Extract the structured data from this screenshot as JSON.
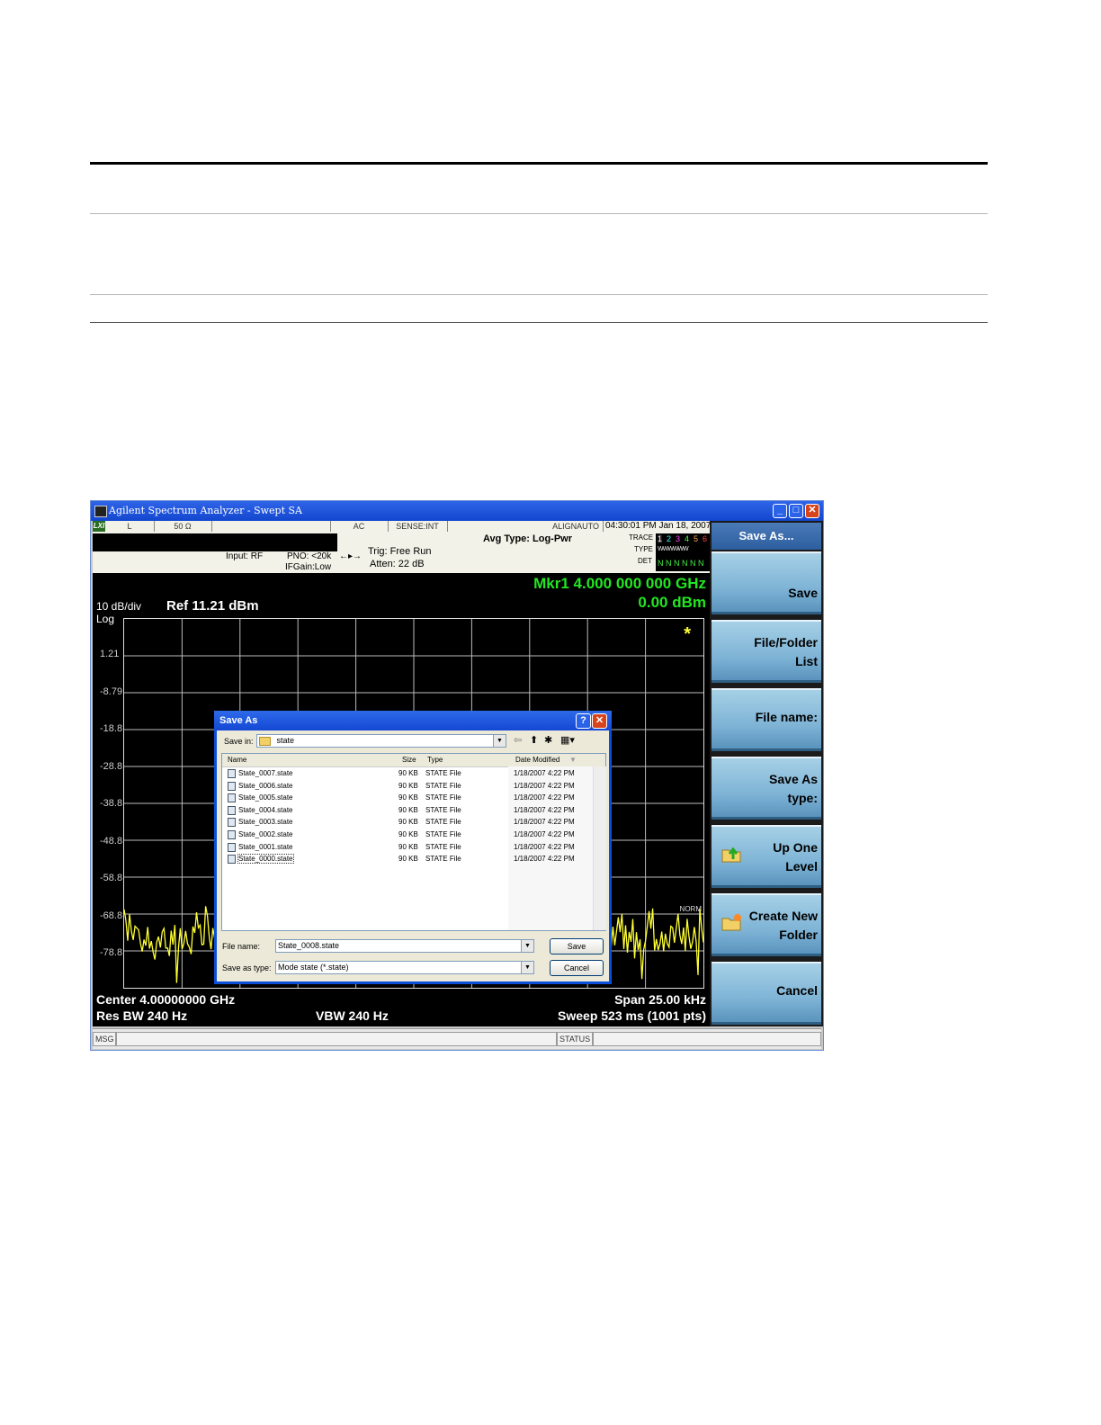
{
  "window": {
    "title": "Agilent Spectrum Analyzer - Swept SA"
  },
  "status": {
    "lxi": "LXI",
    "cells": [
      "L",
      "50 Ω",
      "",
      "AC",
      "SENSE:INT",
      "ALIGNAUTO"
    ],
    "datetime": "04:30:01 PM Jan 18, 2007",
    "input": "Input: RF",
    "pno": "PNO: <20k",
    "ifgain": "IFGain:Low",
    "trig": "Trig: Free Run",
    "atten": "Atten: 22 dB",
    "avg_type": "Avg Type: Log-Pwr",
    "trace_label": "TRACE",
    "type_label": "TYPE",
    "det_label": "DET",
    "trace_digits": [
      "1",
      "2",
      "3",
      "4",
      "5",
      "6"
    ],
    "type_value": "WWWWWW",
    "det_value": "N N N N N N"
  },
  "screen": {
    "scale": "10 dB/div",
    "log": "Log",
    "ref": "Ref 11.21 dBm",
    "marker_freq": "Mkr1 4.000 000 000 GHz",
    "marker_amp": "0.00 dBm",
    "y_ticks": [
      "1.21",
      "-8.79",
      "-18.8",
      "-28.8",
      "-38.8",
      "-48.8",
      "-58.8",
      "-68.8",
      "-78.8"
    ],
    "norm": "NORM",
    "star": "*",
    "center": "Center 4.00000000 GHz",
    "res_bw": "Res BW 240 Hz",
    "vbw": "VBW 240 Hz",
    "span": "Span 25.00 kHz",
    "sweep": "Sweep  523 ms (1001 pts)"
  },
  "softkeys": {
    "title": "Save As...",
    "keys": [
      {
        "line1": "Save",
        "line2": ""
      },
      {
        "line1": "File/Folder",
        "line2": "List"
      },
      {
        "line1": "File name:",
        "line2": ""
      },
      {
        "line1": "Save As",
        "line2": "type:"
      },
      {
        "line1": "Up One",
        "line2": "Level"
      },
      {
        "line1": "Create New",
        "line2": "Folder"
      },
      {
        "line1": "Cancel",
        "line2": ""
      }
    ]
  },
  "bottom": {
    "msg": "MSG",
    "status": "STATUS"
  },
  "dialog": {
    "title": "Save As",
    "save_in_label": "Save in:",
    "save_in_value": "state",
    "columns": {
      "name": "Name",
      "size": "Size",
      "type": "Type",
      "date": "Date Modified"
    },
    "files": [
      {
        "name": "State_0007.state",
        "size": "90 KB",
        "type": "STATE File",
        "date": "1/18/2007 4:22 PM"
      },
      {
        "name": "State_0006.state",
        "size": "90 KB",
        "type": "STATE File",
        "date": "1/18/2007 4:22 PM"
      },
      {
        "name": "State_0005.state",
        "size": "90 KB",
        "type": "STATE File",
        "date": "1/18/2007 4:22 PM"
      },
      {
        "name": "State_0004.state",
        "size": "90 KB",
        "type": "STATE File",
        "date": "1/18/2007 4:22 PM"
      },
      {
        "name": "State_0003.state",
        "size": "90 KB",
        "type": "STATE File",
        "date": "1/18/2007 4:22 PM"
      },
      {
        "name": "State_0002.state",
        "size": "90 KB",
        "type": "STATE File",
        "date": "1/18/2007 4:22 PM"
      },
      {
        "name": "State_0001.state",
        "size": "90 KB",
        "type": "STATE File",
        "date": "1/18/2007 4:22 PM"
      },
      {
        "name": "State_0000.state",
        "size": "90 KB",
        "type": "STATE File",
        "date": "1/18/2007 4:22 PM"
      }
    ],
    "file_name_label": "File name:",
    "file_name_value": "State_0008.state",
    "save_type_label": "Save as type:",
    "save_type_value": "Mode state (*.state)",
    "save_button": "Save",
    "cancel_button": "Cancel"
  },
  "colors": {
    "trace": "#ffff33",
    "marker": "#22e622",
    "softkey": "#7fb4d6",
    "title_bar": "#1a4fd8"
  }
}
